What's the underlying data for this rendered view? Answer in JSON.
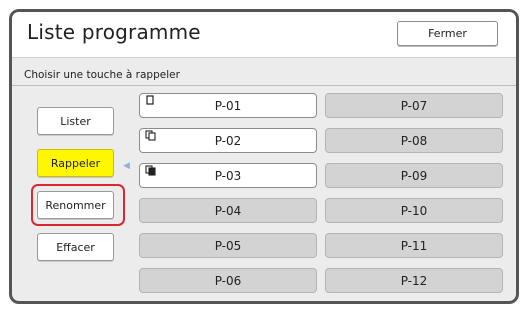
{
  "header": {
    "title": "Liste programme",
    "close_label": "Fermer"
  },
  "instruction": "Choisir une touche à rappeler",
  "side_buttons": [
    {
      "label": "Lister",
      "state": "normal"
    },
    {
      "label": "Rappeler",
      "state": "selected"
    },
    {
      "label": "Renommer",
      "state": "highlighted"
    },
    {
      "label": "Effacer",
      "state": "normal"
    }
  ],
  "programs": [
    {
      "label": "P-01",
      "icon": "single-doc-icon",
      "filled": true
    },
    {
      "label": "P-02",
      "icon": "stacked-doc-icon",
      "filled": true
    },
    {
      "label": "P-03",
      "icon": "stacked-doc-filled-icon",
      "filled": true
    },
    {
      "label": "P-04",
      "filled": false
    },
    {
      "label": "P-05",
      "filled": false
    },
    {
      "label": "P-06",
      "filled": false
    },
    {
      "label": "P-07",
      "filled": false
    },
    {
      "label": "P-08",
      "filled": false
    },
    {
      "label": "P-09",
      "filled": false
    },
    {
      "label": "P-10",
      "filled": false
    },
    {
      "label": "P-11",
      "filled": false
    },
    {
      "label": "P-12",
      "filled": false
    }
  ],
  "colors": {
    "selected": "#fff700",
    "highlight": "#d9282f",
    "empty_slot": "#d3d3d3",
    "frame": "#555555"
  }
}
